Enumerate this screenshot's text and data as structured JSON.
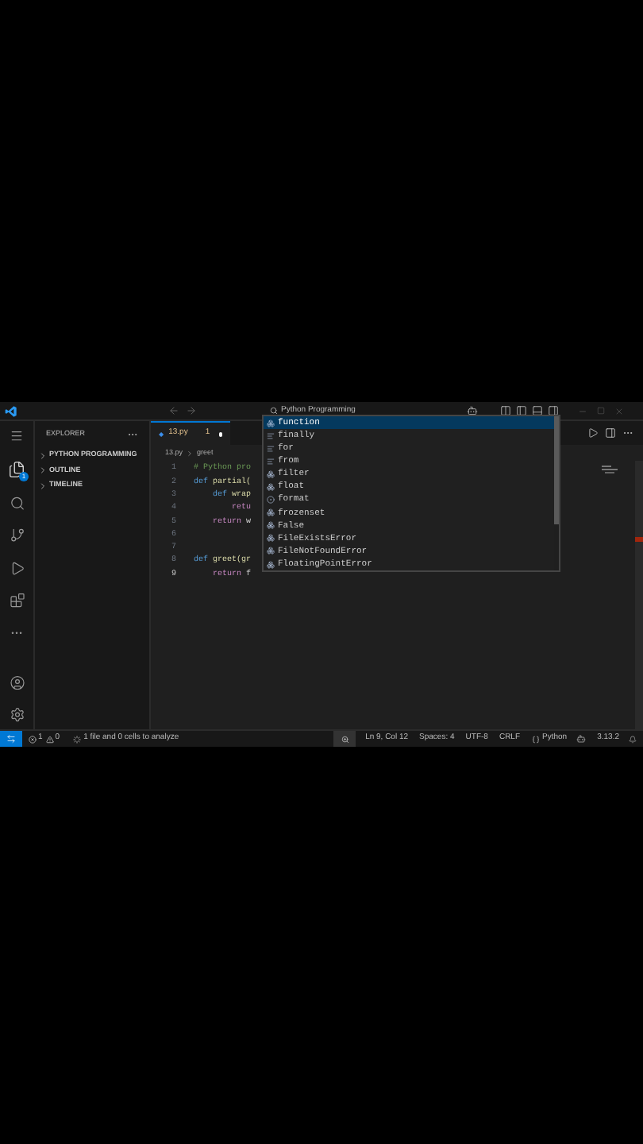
{
  "title_bar": {
    "search": "Python Programming"
  },
  "activity_bar": {
    "explorer_badge": "1"
  },
  "sidebar": {
    "title": "EXPLORER",
    "sections": [
      {
        "label": "PYTHON PROGRAMMING",
        "expanded": false
      },
      {
        "label": "OUTLINE",
        "expanded": false
      },
      {
        "label": "TIMELINE",
        "expanded": false
      }
    ]
  },
  "tabs": [
    {
      "label": "13.py",
      "problems": "1",
      "modified": true,
      "selected": true
    }
  ],
  "breadcrumb": [
    "13.py",
    "greet"
  ],
  "code_lines": [
    {
      "number": "1",
      "current": false,
      "tokens": [
        {
          "text": "# Python pro",
          "kind": "comment"
        }
      ]
    },
    {
      "number": "2",
      "current": false,
      "tokens": [
        {
          "text": "def ",
          "kind": "keyword"
        },
        {
          "text": "partial(",
          "kind": "function"
        }
      ]
    },
    {
      "number": "3",
      "current": false,
      "tokens": [
        {
          "text": "    def ",
          "kind": "keyword"
        },
        {
          "text": "wrap",
          "kind": "function"
        }
      ]
    },
    {
      "number": "4",
      "current": false,
      "tokens": [
        {
          "text": "        retu",
          "kind": "control"
        }
      ]
    },
    {
      "number": "5",
      "current": false,
      "tokens": [
        {
          "text": "    return ",
          "kind": "control"
        },
        {
          "text": "w",
          "kind": "plain"
        }
      ]
    },
    {
      "number": "6",
      "current": false
    },
    {
      "number": "7",
      "current": false
    },
    {
      "number": "8",
      "current": false,
      "tokens": [
        {
          "text": "def ",
          "kind": "keyword"
        },
        {
          "text": "greet(gr",
          "kind": "function"
        }
      ]
    },
    {
      "number": "9",
      "current": true,
      "tokens": [
        {
          "text": "    return ",
          "kind": "control"
        },
        {
          "text": "f",
          "kind": "plain"
        }
      ]
    }
  ],
  "suggestions": [
    {
      "label": "function",
      "kind": "class",
      "selected": true
    },
    {
      "label": "finally",
      "kind": "keyword",
      "selected": false
    },
    {
      "label": "for",
      "kind": "keyword",
      "selected": false
    },
    {
      "label": "from",
      "kind": "keyword",
      "selected": false
    },
    {
      "label": "filter",
      "kind": "class",
      "selected": false
    },
    {
      "label": "float",
      "kind": "class",
      "selected": false
    },
    {
      "label": "format",
      "kind": "function",
      "selected": false
    },
    {
      "label": "frozenset",
      "kind": "class",
      "selected": false
    },
    {
      "label": "False",
      "kind": "class",
      "selected": false
    },
    {
      "label": "FileExistsError",
      "kind": "class",
      "selected": false
    },
    {
      "label": "FileNotFoundError",
      "kind": "class",
      "selected": false
    },
    {
      "label": "FloatingPointError",
      "kind": "class",
      "selected": false
    }
  ],
  "status_bar": {
    "errors": "1",
    "warnings": "0",
    "analysis": "1 file and 0 cells to analyze",
    "position": "Ln 9, Col 12",
    "spaces": "Spaces: 4",
    "encoding": "UTF-8",
    "eol": "CRLF",
    "language": "Python",
    "version": "3.13.2"
  }
}
